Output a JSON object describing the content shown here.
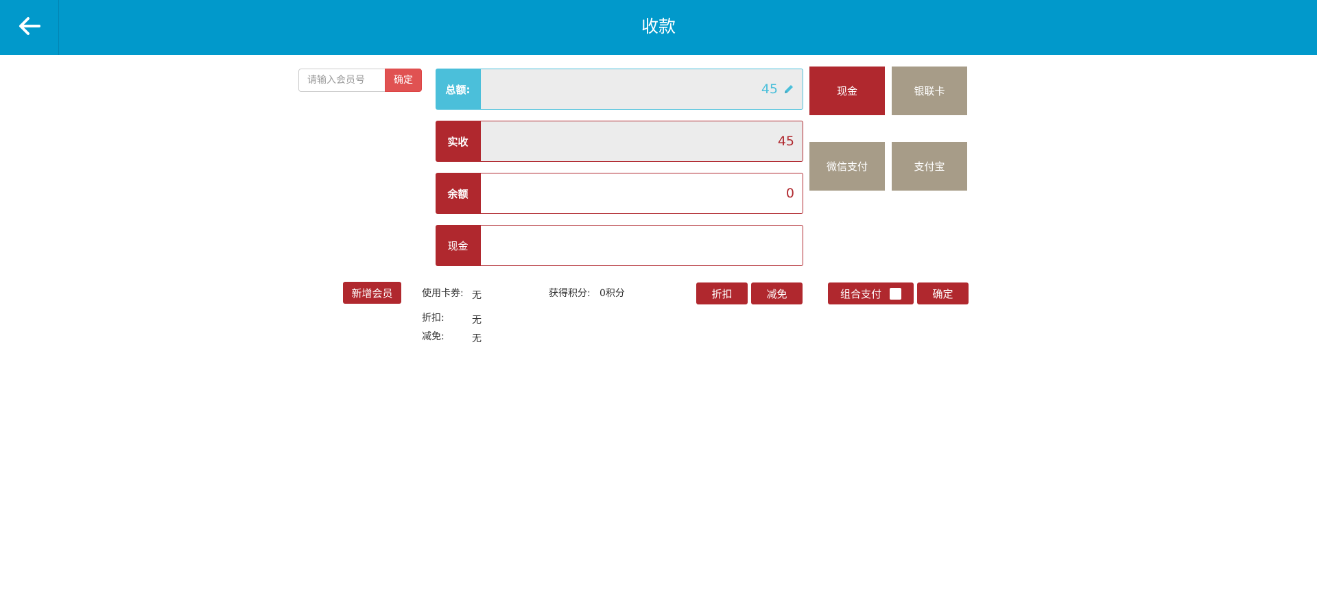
{
  "header": {
    "title": "收款",
    "back_icon": "arrow-left-icon"
  },
  "member": {
    "placeholder": "请输入会员号",
    "value": "",
    "confirm_label": "确定"
  },
  "amounts": {
    "total_label": "总额:",
    "total_value": "45",
    "received_label": "实收",
    "received_value": "45",
    "balance_label": "余额",
    "balance_value": "0",
    "cash_label": "现金",
    "cash_value": ""
  },
  "payment_methods": {
    "cash": "现金",
    "unionpay": "银联卡",
    "wechat": "微信支付",
    "alipay": "支付宝"
  },
  "info": {
    "coupon_label": "使用卡券:",
    "coupon_value": "无",
    "points_label": "获得积分:",
    "points_value": "0积分",
    "discount_label": "折扣:",
    "discount_value": "无",
    "waive_label": "减免:",
    "waive_value": "无"
  },
  "actions": {
    "add_member": "新增会员",
    "discount": "折扣",
    "waive": "减免",
    "combo_pay": "组合支付",
    "combo_checked": false,
    "confirm": "确定"
  },
  "colors": {
    "header": "#0199cb",
    "primary_red": "#b0282e",
    "accent_blue": "#4bbfda",
    "neutral": "#a79c88"
  }
}
